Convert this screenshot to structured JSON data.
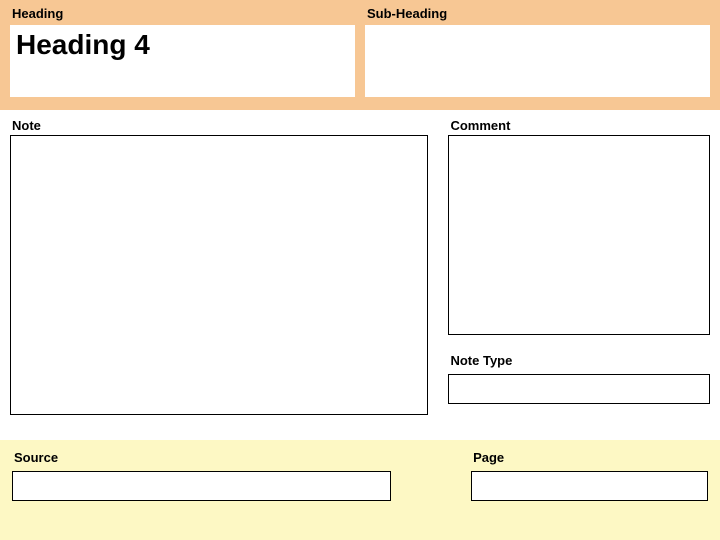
{
  "header": {
    "heading_label": "Heading",
    "subheading_label": "Sub-Heading",
    "heading_value": "Heading 4",
    "subheading_value": ""
  },
  "note": {
    "label": "Note",
    "value": ""
  },
  "comment": {
    "label": "Comment",
    "value": ""
  },
  "notetype": {
    "label": "Note Type",
    "value": ""
  },
  "source": {
    "label": "Source",
    "value": ""
  },
  "page": {
    "label": "Page",
    "value": ""
  }
}
